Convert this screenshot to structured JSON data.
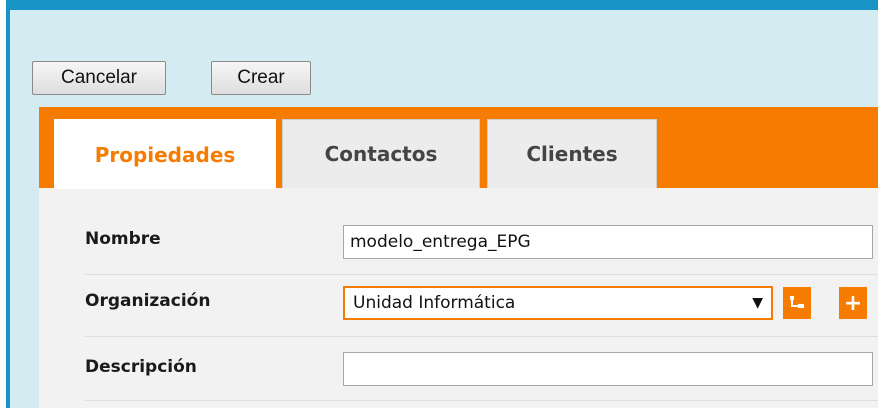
{
  "actions": {
    "cancel_label": "Cancelar",
    "create_label": "Crear"
  },
  "tabs": [
    {
      "label": "Propiedades",
      "active": true
    },
    {
      "label": "Contactos",
      "active": false
    },
    {
      "label": "Clientes",
      "active": false
    }
  ],
  "form": {
    "name": {
      "label": "Nombre",
      "value": "modelo_entrega_EPG"
    },
    "organization": {
      "label": "Organización",
      "selected": "Unidad Informática"
    },
    "description": {
      "label": "Descripción",
      "value": ""
    }
  },
  "icons": {
    "tree": "hierarchy-icon",
    "add": "plus-icon",
    "dropdown": "caret-down-icon"
  },
  "colors": {
    "accent": "#f57c00",
    "frame": "#1793c6",
    "background": "#d5ebf2"
  }
}
